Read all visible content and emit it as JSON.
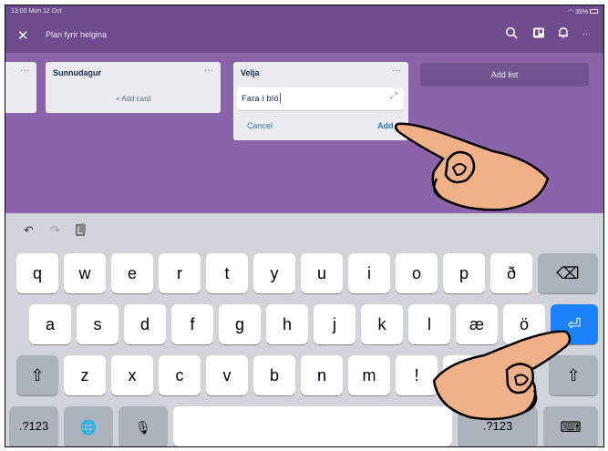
{
  "status": {
    "time": "13:00  Mon 12 Oct",
    "battery": "39%"
  },
  "header": {
    "close_glyph": "✕",
    "title": "Plan fyrir helgina",
    "icons": [
      "search-icon",
      "board-icon",
      "bell-icon",
      "more-icon"
    ],
    "more_glyph": "···"
  },
  "board": {
    "partial_list_menu": "···",
    "lists": [
      {
        "title": "Sunnudagur",
        "menu": "···",
        "add_card": "+ Add card"
      },
      {
        "title": "Velja",
        "menu": "···",
        "input_value": "Fara í bíó",
        "cancel": "Cancel",
        "add": "Add"
      }
    ],
    "add_list": "Add list"
  },
  "keyboard": {
    "toolbar": [
      "undo-icon",
      "redo-icon",
      "paste-icon"
    ],
    "row1": [
      "q",
      "w",
      "e",
      "r",
      "t",
      "y",
      "u",
      "i",
      "o",
      "p",
      "ð"
    ],
    "row2": [
      "a",
      "s",
      "d",
      "f",
      "g",
      "h",
      "j",
      "k",
      "l",
      "æ",
      "ö"
    ],
    "row3": [
      "z",
      "x",
      "c",
      "v",
      "b",
      "n",
      "m",
      "!"
    ],
    "numbers_label": ".?123",
    "numbers_label_right": ".?123",
    "glyphs": {
      "delete": "⌫",
      "return": "⏎",
      "shift": "⇧",
      "globe": "🌐",
      "mic": "🎙",
      "hide": "⌨"
    }
  }
}
